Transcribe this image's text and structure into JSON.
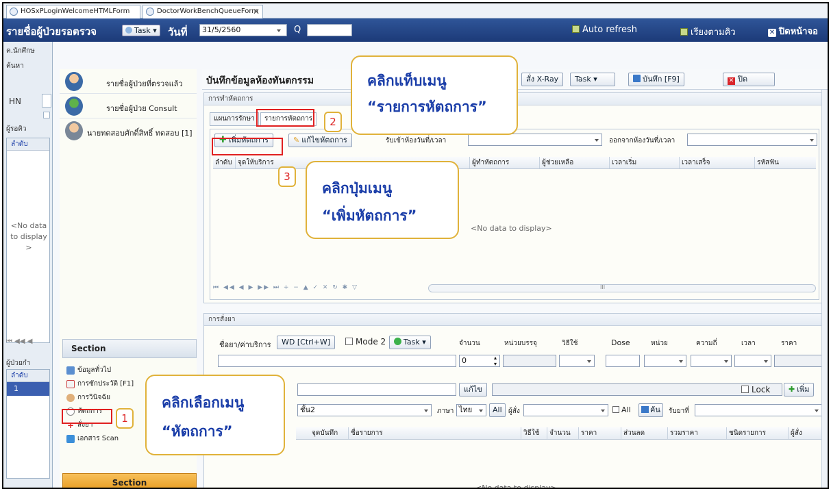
{
  "window_tabs": [
    "HOSxPLoginWelcomeHTMLForm",
    "DoctorWorkBenchQueueForm"
  ],
  "topbar": {
    "title": "รายชื่อผู้ป่วยรอตรวจ",
    "task_label": "Task",
    "date_label": "วันที่",
    "date_value": "31/5/2560",
    "q_label": "Q",
    "auto_refresh": "Auto refresh",
    "sort_queue": "เรียงตามคิว",
    "close_screen": "ปิดหน้าจอ"
  },
  "left": {
    "search_header": "ค้นหา",
    "clinic_label": "ค.นักศึกษ",
    "hn_label": "HN",
    "waiting_label": "ผู้รอคิว",
    "col_order": "ลำดับ",
    "no_data": "<No data to display>",
    "patients_label": "ผู้ป่วยกำ",
    "order_col2": "ลำดับ",
    "row_value": "1"
  },
  "nav": {
    "examined": "รายชื่อผู้ป่วยที่ตรวจแล้ว",
    "consult": "รายชื่อผู้ป่วย Consult",
    "patient": "นายทดสอบศักดิ์สิทธิ์ ทดสอบ [1]",
    "section_header": "Section",
    "section_items": [
      "ข้อมูลทั่วไป",
      "การซักประวัติ [F1]",
      "การวินิจฉัย",
      "หัตถการ",
      "สั่งยา",
      "เอกสาร Scan"
    ],
    "section_footer": "Section"
  },
  "main": {
    "title": "บันทึกข้อมูลห้องทันตกรรม",
    "xray_btn": "สั่ง X-Ray",
    "task_btn": "Task",
    "save_btn": "บันทึก [F9]",
    "close_btn": "ปิด",
    "procedure_group": "การทำหัตถการ",
    "tab_treatment_plan": "แผนการรักษา",
    "tab_procedure_list": "รายการหัตถการ",
    "add_procedure": "เพิ่มหัตถการ",
    "edit_procedure": "แก้ไขหัตถการ",
    "room_in": "รับเข้าห้องวันที่/เวลา",
    "room_out": "ออกจากห้องวันที่/เวลา",
    "columns": [
      "ลำดับ",
      "จุดให้บริการ",
      "ผู้ทำหัตถการ",
      "ผู้ช่วยเหลือ",
      "เวลาเริ่ม",
      "เวลาเสร็จ",
      "รหัสฟัน"
    ],
    "no_data": "<No data to display>",
    "scroll_label": "III",
    "rx_group": "การสั่งยา",
    "rx_drug_label": "ชื่อยา/ค่าบริการ",
    "rx_wd": "WD [Ctrl+W]",
    "rx_mode2": "Mode 2",
    "rx_task": "Task",
    "rx_cols": [
      "จำนวน",
      "หน่วยบรรจุ",
      "วิธีใช้",
      "Dose",
      "หน่วย",
      "ความถี่",
      "เวลา",
      "ราคา"
    ],
    "rx_qty": "0",
    "rx_edit": "แก้ไข",
    "rx_lock": "Lock",
    "rx_add": "เพิ่ม",
    "rx_shelf": "ชั้น2",
    "rx_lang_label": "ภาษา",
    "rx_lang": "ไทย",
    "rx_all": "All",
    "rx_orderer": "ผู้สั่ง",
    "rx_all2": "All",
    "rx_search": "ค้น",
    "rx_receiver": "รับยาที่",
    "rx_list_cols": [
      "จุดบันทึก",
      "ชื่อรายการ",
      "วิธีใช้",
      "จำนวน",
      "ราคา",
      "ส่วนลด",
      "รวมราคา",
      "ชนิดรายการ",
      "ผู้สั่ง"
    ],
    "rx_no_data": "<No data to display>"
  },
  "callouts": {
    "c1_line1": "คลิกแท็บเมนู",
    "c1_line2": "“รายการหัตถการ”",
    "c2_line1": "คลิกปุ่มเมนู",
    "c2_line2": "“เพิ่มหัตถการ”",
    "c3_line1": "คลิกเลือกเมนู",
    "c3_line2": "“หัตถการ”",
    "n1": "1",
    "n2": "2",
    "n3": "3"
  },
  "colors": {
    "topbar": "#1c3a78",
    "callout_border": "#e0b23a",
    "callout_text": "#1a3da8",
    "highlight": "#e02020"
  }
}
